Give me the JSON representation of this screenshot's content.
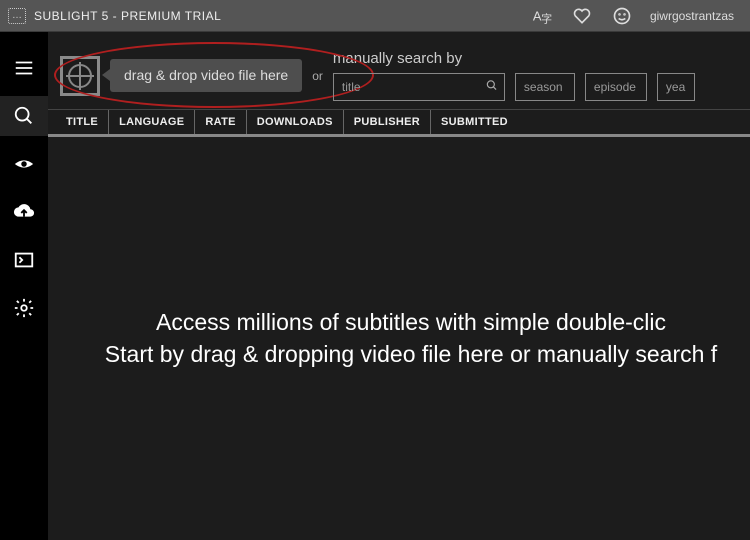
{
  "titlebar": {
    "title": "SUBLIGHT 5 - PREMIUM TRIAL",
    "user": "giwrgostrantzas"
  },
  "sidebar": {
    "items": [
      "menu",
      "search",
      "eye",
      "cloud-upload",
      "terminal",
      "settings"
    ]
  },
  "search": {
    "drop_text": "drag & drop video file here",
    "or": "or",
    "manual_label": "manually search by",
    "placeholders": {
      "title": "title",
      "season": "season",
      "episode": "episode",
      "year": "year"
    }
  },
  "columns": [
    "TITLE",
    "LANGUAGE",
    "RATE",
    "DOWNLOADS",
    "PUBLISHER",
    "SUBMITTED"
  ],
  "hero": {
    "line1": "Access millions of subtitles with simple double-clic",
    "line2": "Start by drag & dropping video file here or manually search f"
  }
}
